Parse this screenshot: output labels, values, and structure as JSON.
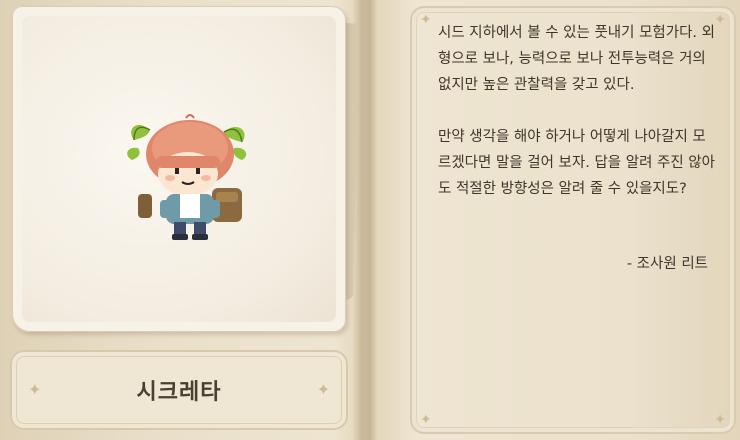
{
  "character": {
    "name": "시크레타",
    "portrait_icon": "sikreta-sprite"
  },
  "description": {
    "paragraph1": "시드 지하에서 볼 수 있는 풋내기 모험가다. 외형으로 보나, 능력으로 보나 전투능력은 거의 없지만  높은 관찰력을 갖고 있다.",
    "paragraph2": "만약 생각을 해야 하거나 어떻게 나아갈지 모르겠다면 말을 걸어 보자. 답을 알려 주진 않아도 적절한 방향성은 알려 줄 수 있을지도?",
    "signature": "- 조사원 리트"
  },
  "colors": {
    "paper": "#eee5d1",
    "text": "#3f362c",
    "ornament": "#cdbb95"
  }
}
